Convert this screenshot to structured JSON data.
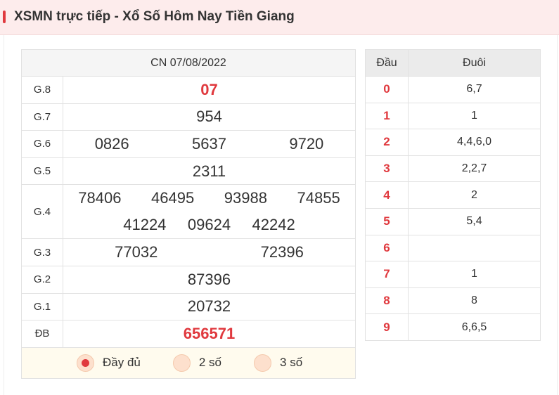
{
  "header": {
    "title": "XSMN trực tiếp - Xổ Số Hôm Nay Tiền Giang"
  },
  "result": {
    "date": "CN 07/08/2022",
    "prizes": [
      {
        "label": "G.8",
        "numbers": [
          "07"
        ]
      },
      {
        "label": "G.7",
        "numbers": [
          "954"
        ]
      },
      {
        "label": "G.6",
        "numbers": [
          "0826",
          "5637",
          "9720"
        ]
      },
      {
        "label": "G.5",
        "numbers": [
          "2311"
        ]
      },
      {
        "label": "G.4",
        "numbers": [
          "78406",
          "46495",
          "93988",
          "74855",
          "41224",
          "09624",
          "42242"
        ]
      },
      {
        "label": "G.3",
        "numbers": [
          "77032",
          "72396"
        ]
      },
      {
        "label": "G.2",
        "numbers": [
          "87396"
        ]
      },
      {
        "label": "G.1",
        "numbers": [
          "20732"
        ]
      },
      {
        "label": "ĐB",
        "numbers": [
          "656571"
        ]
      }
    ],
    "filters": [
      {
        "label": "Đầy đủ",
        "selected": true
      },
      {
        "label": "2 số",
        "selected": false
      },
      {
        "label": "3 số",
        "selected": false
      }
    ]
  },
  "loto": {
    "headers": [
      "Đầu",
      "Đuôi"
    ],
    "rows": [
      {
        "dau": "0",
        "duoi": "6,7"
      },
      {
        "dau": "1",
        "duoi": "1"
      },
      {
        "dau": "2",
        "duoi": "4,4,6,0"
      },
      {
        "dau": "3",
        "duoi": "2,2,7"
      },
      {
        "dau": "4",
        "duoi": "2"
      },
      {
        "dau": "5",
        "duoi": "5,4"
      },
      {
        "dau": "6",
        "duoi": ""
      },
      {
        "dau": "7",
        "duoi": "1"
      },
      {
        "dau": "8",
        "duoi": "8"
      },
      {
        "dau": "9",
        "duoi": "6,6,5"
      }
    ]
  },
  "colors": {
    "accent": "#e0393e",
    "header_bg": "#fdecec",
    "filter_bg": "#fffbee"
  }
}
